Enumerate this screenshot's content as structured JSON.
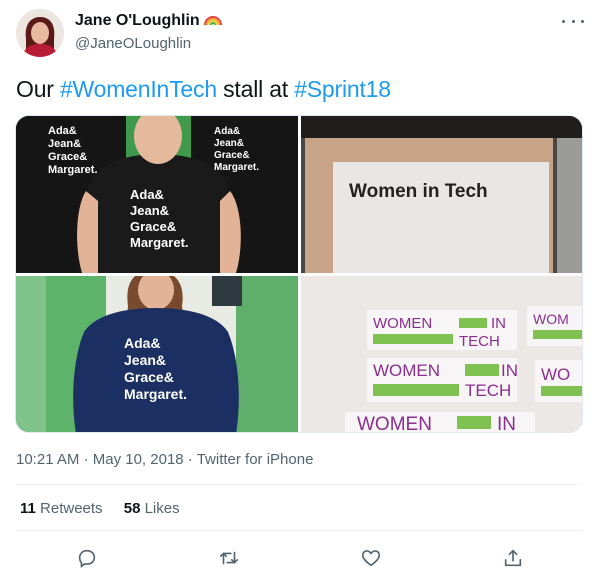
{
  "author": {
    "name": "Jane O'Loughlin",
    "handle": "@JaneOLoughlin",
    "badge_icon": "rainbow-icon"
  },
  "tweet": {
    "text_prefix": "Our ",
    "hashtag1": "#WomenInTech",
    "text_middle": " stall at ",
    "hashtag2": "#Sprint18"
  },
  "photos": {
    "shirt_lines": [
      "Ada&",
      "Jean&",
      "Grace&",
      "Margaret."
    ],
    "sign_text": "Women in Tech",
    "sticker_words": [
      "WOMEN",
      "IN",
      "TECH"
    ],
    "sticker_partial": [
      "WOM",
      "WO"
    ]
  },
  "meta": {
    "time": "10:21 AM",
    "separator": " · ",
    "date": "May 10, 2018",
    "source": "Twitter for iPhone"
  },
  "stats": {
    "retweets_count": "11",
    "retweets_label": "Retweets",
    "likes_count": "58",
    "likes_label": "Likes"
  },
  "colors": {
    "link": "#1d9bf0",
    "secondary_text": "#536471",
    "tshirt_green": "#5fae6b",
    "sticker_purple": "#8b2f8f",
    "sticker_green": "#7fc251"
  },
  "actions": [
    "reply-icon",
    "retweet-icon",
    "like-icon",
    "share-icon"
  ]
}
